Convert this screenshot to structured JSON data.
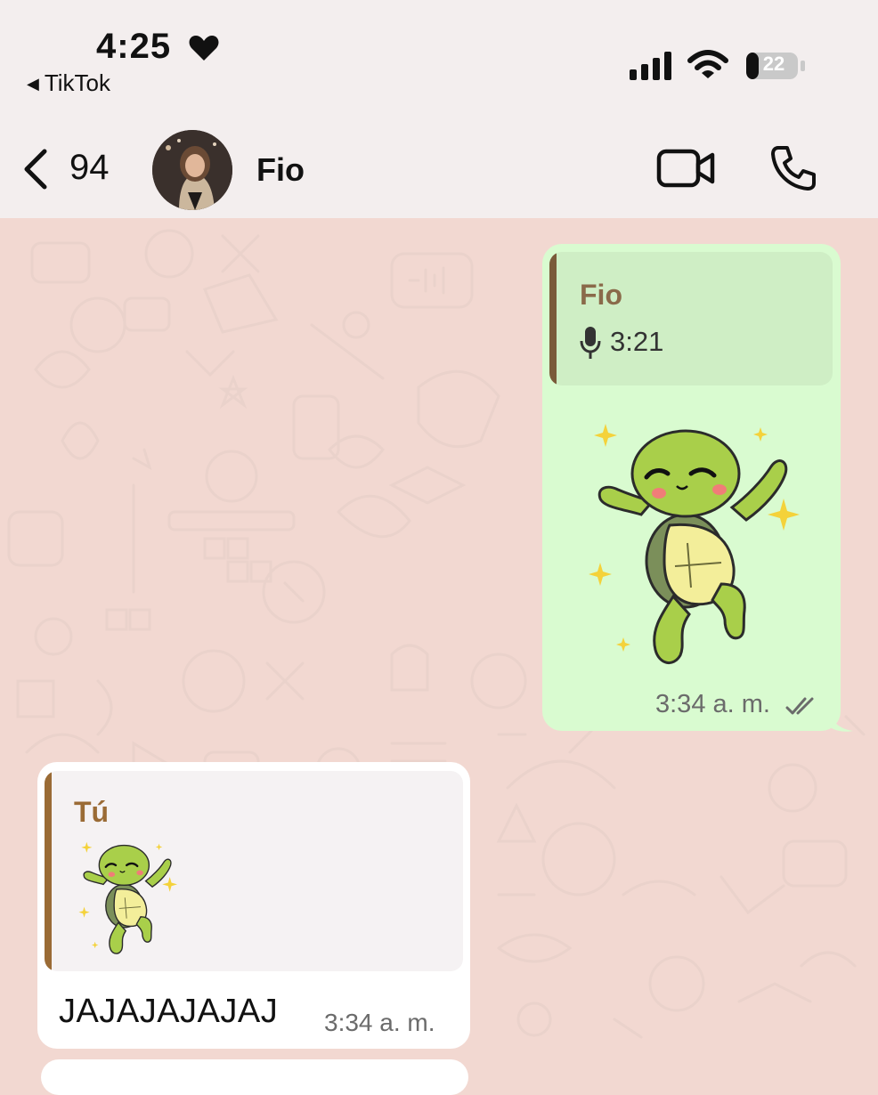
{
  "status_bar": {
    "time": "4:25",
    "back_app": "TikTok",
    "battery": "22"
  },
  "header": {
    "back_count": "94",
    "contact_name": "Fio",
    "icons": [
      "chevron-left-icon",
      "avatar",
      "video-call-icon",
      "phone-call-icon"
    ]
  },
  "messages": [
    {
      "direction": "outgoing",
      "quote": {
        "author": "Fio",
        "type": "voice",
        "duration": "3:21"
      },
      "content": "turtle-sticker",
      "time": "3:34 a. m.",
      "status": "read"
    },
    {
      "direction": "incoming",
      "quote": {
        "author": "Tú",
        "type": "sticker"
      },
      "text": "JAJAJAJAJAJ",
      "time": "3:34 a. m."
    }
  ],
  "colors": {
    "outgoing_bubble": "#d9fbd0",
    "incoming_bubble": "#ffffff",
    "chat_background": "#f2d8d1",
    "quote_author_out": "#8a6a4a",
    "quote_author_in": "#9a6b35"
  }
}
